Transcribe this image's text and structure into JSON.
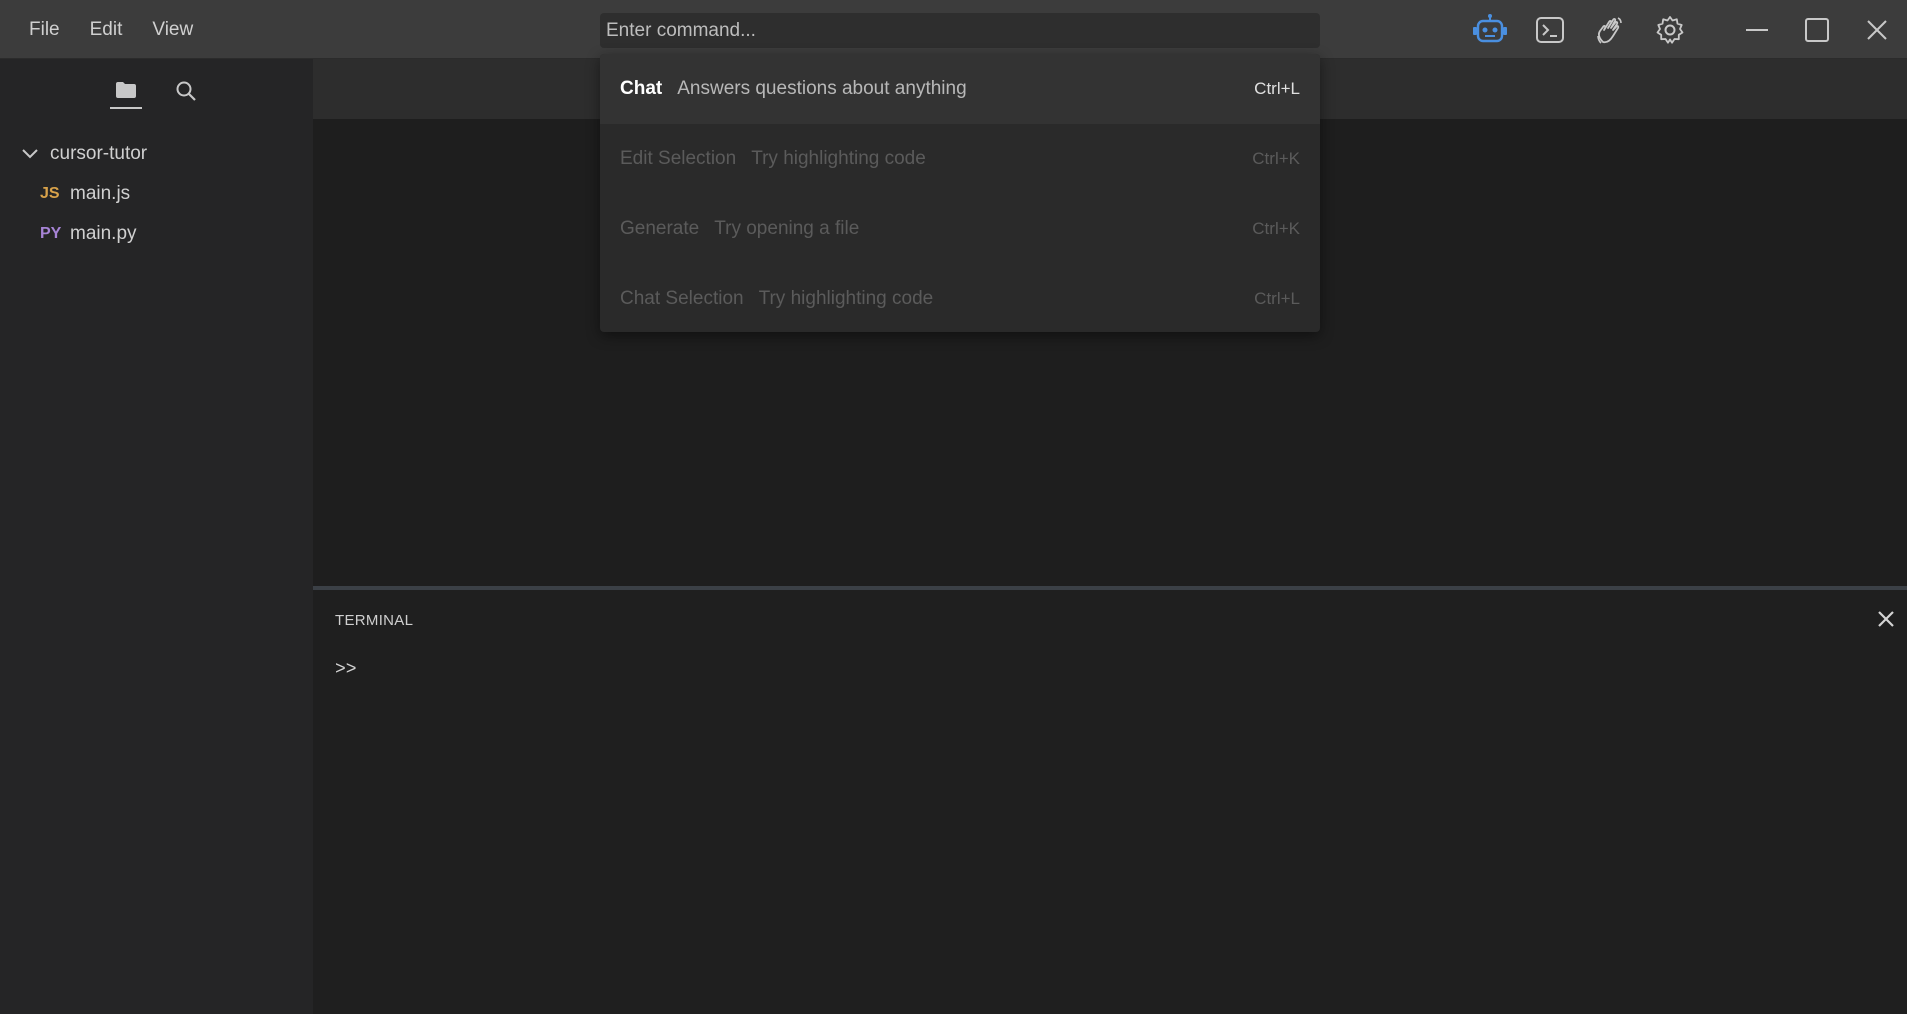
{
  "menu": {
    "file": "File",
    "edit": "Edit",
    "view": "View"
  },
  "command_bar": {
    "placeholder": "Enter command...",
    "value": ""
  },
  "top_icons": [
    "robot-icon",
    "terminal-icon",
    "wave-hand-icon",
    "gear-icon"
  ],
  "window_controls": [
    "minimize-icon",
    "maximize-icon",
    "close-icon"
  ],
  "sidebar": {
    "tabs": [
      "folder-icon",
      "search-icon"
    ],
    "folder": "cursor-tutor",
    "files": [
      {
        "badge": "JS",
        "name": "main.js"
      },
      {
        "badge": "PY",
        "name": "main.py"
      }
    ]
  },
  "dropdown": {
    "items": [
      {
        "name": "Chat",
        "desc": "Answers questions about anything",
        "key": "Ctrl+L",
        "state": "selected"
      },
      {
        "name": "Edit Selection",
        "desc": "Try highlighting code",
        "key": "Ctrl+K",
        "state": "disabled"
      },
      {
        "name": "Generate",
        "desc": "Try opening a file",
        "key": "Ctrl+K",
        "state": "disabled"
      },
      {
        "name": "Chat Selection",
        "desc": "Try highlighting code",
        "key": "Ctrl+L",
        "state": "disabled"
      }
    ]
  },
  "terminal": {
    "title": "TERMINAL",
    "prompt": ">>"
  },
  "colors": {
    "accent_robot": "#4a8fe0",
    "js_badge": "#d8a24a",
    "py_badge": "#a784d6"
  }
}
